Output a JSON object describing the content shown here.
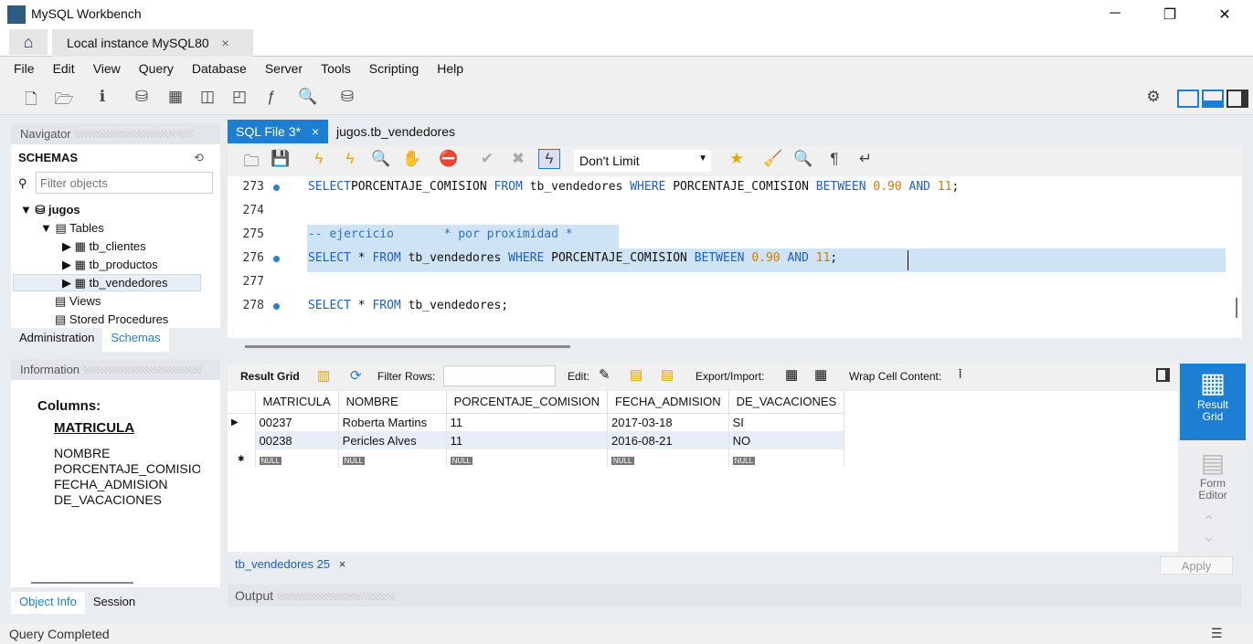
{
  "window": {
    "title": "MySQL Workbench",
    "minimize": "─",
    "maximize": "❐",
    "close": "✕"
  },
  "tabs": {
    "connection": "Local instance MySQL80",
    "close": "×"
  },
  "menu": [
    "File",
    "Edit",
    "View",
    "Query",
    "Database",
    "Server",
    "Tools",
    "Scripting",
    "Help"
  ],
  "navigator": {
    "title": "Navigator",
    "schemas_label": "SCHEMAS",
    "filter_placeholder": "Filter objects",
    "schema": "jugos",
    "tables_label": "Tables",
    "tables": [
      "tb_clientes",
      "tb_productos",
      "tb_vendedores"
    ],
    "views": "Views",
    "procs": "Stored Procedures",
    "tab_admin": "Administration",
    "tab_schemas": "Schemas"
  },
  "information": {
    "title": "Information",
    "columns_label": "Columns:",
    "pk": "MATRICULA",
    "columns": [
      "NOMBRE",
      "PORCENTAJE_COMISIO",
      "FECHA_ADMISION",
      "DE_VACACIONES"
    ],
    "tab_object": "Object Info",
    "tab_session": "Session"
  },
  "editor": {
    "tabs": [
      "SQL File 3*",
      "jugos.tb_vendedores"
    ],
    "limit": "Don't Limit",
    "lines": [
      {
        "n": "273",
        "dot": true,
        "parts": [
          [
            "kw",
            "SELECT"
          ],
          [
            "",
            "PORCENTAJE_COMISION "
          ],
          [
            "kw",
            "FROM"
          ],
          [
            "",
            " tb_vendedores "
          ],
          [
            "kw",
            "WHERE"
          ],
          [
            "",
            " PORCENTAJE_COMISION "
          ],
          [
            "kw",
            "BETWEEN"
          ],
          [
            "",
            " "
          ],
          [
            "num",
            "0.90"
          ],
          [
            "",
            " "
          ],
          [
            "kw",
            "AND"
          ],
          [
            "",
            " "
          ],
          [
            "num",
            "11"
          ],
          [
            "",
            ";"
          ]
        ]
      },
      {
        "n": "274",
        "dot": false,
        "parts": []
      },
      {
        "n": "275",
        "dot": false,
        "parts": [
          [
            "cm",
            "-- ejercicio       * por proximidad *"
          ]
        ]
      },
      {
        "n": "276",
        "dot": true,
        "parts": [
          [
            "kw",
            "SELECT"
          ],
          [
            "",
            " * "
          ],
          [
            "kw",
            "FROM"
          ],
          [
            "",
            " tb_vendedores "
          ],
          [
            "kw",
            "WHERE"
          ],
          [
            "",
            " PORCENTAJE_COMISION "
          ],
          [
            "kw",
            "BETWEEN"
          ],
          [
            "",
            " "
          ],
          [
            "num",
            "0.90"
          ],
          [
            "",
            " "
          ],
          [
            "kw",
            "AND"
          ],
          [
            "",
            " "
          ],
          [
            "num",
            "11"
          ],
          [
            "",
            ";"
          ]
        ]
      },
      {
        "n": "277",
        "dot": false,
        "parts": []
      },
      {
        "n": "278",
        "dot": true,
        "parts": [
          [
            "kw",
            "SELECT"
          ],
          [
            "",
            " * "
          ],
          [
            "kw",
            "FROM"
          ],
          [
            "",
            " tb_vendedores;"
          ]
        ]
      }
    ]
  },
  "result": {
    "grid_label": "Result Grid",
    "filter_label": "Filter Rows:",
    "edit_label": "Edit:",
    "export_label": "Export/Import:",
    "wrap_label": "Wrap Cell Content:",
    "columns": [
      "MATRICULA",
      "NOMBRE",
      "PORCENTAJE_COMISION",
      "FECHA_ADMISION",
      "DE_VACACIONES"
    ],
    "rows": [
      [
        "00237",
        "Roberta Martins",
        "11",
        "2017-03-18",
        "SI"
      ],
      [
        "00238",
        "Pericles Alves",
        "11",
        "2016-08-21",
        "NO"
      ]
    ],
    "null": "NULL",
    "tab": "tb_vendedores 25",
    "apply": "Apply",
    "side_result": "Result Grid",
    "side_form": "Form Editor"
  },
  "output": {
    "title": "Output"
  },
  "status": "Query Completed"
}
